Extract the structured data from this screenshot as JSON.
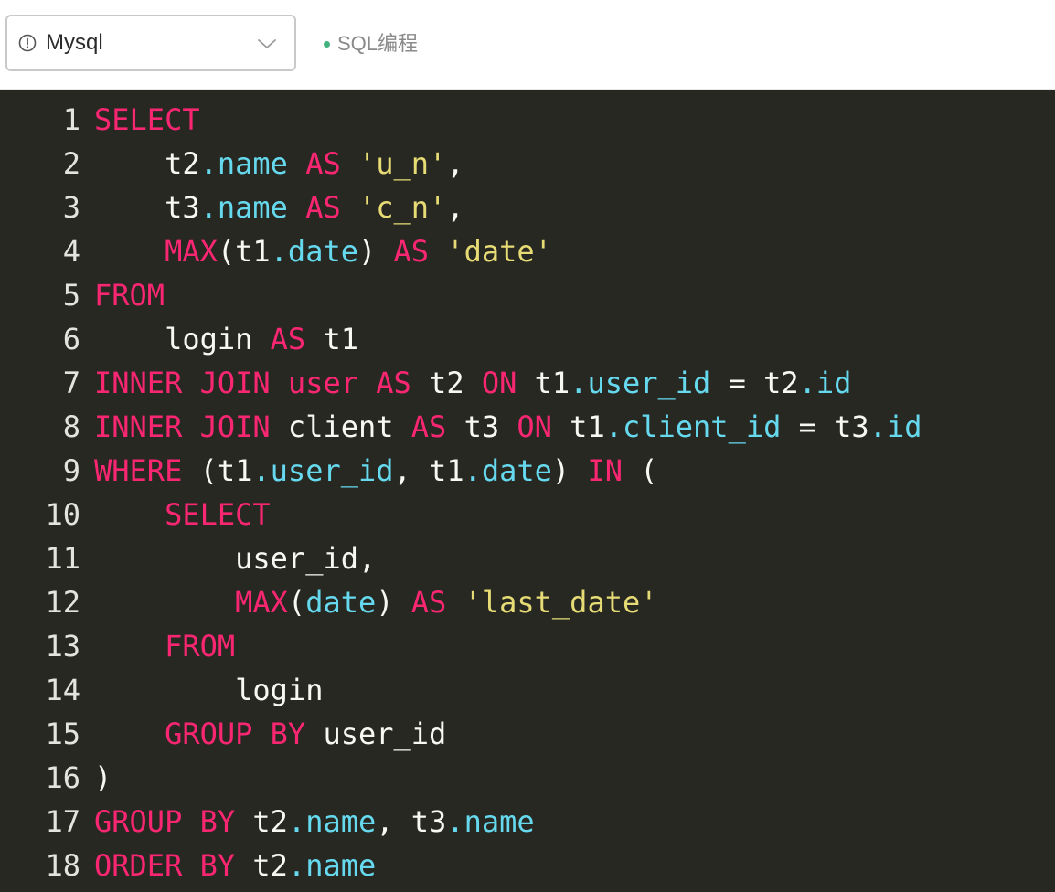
{
  "toolbar": {
    "language_select": {
      "value": "Mysql",
      "icon": "info-circle-icon",
      "chevron": "chevron-down-icon"
    },
    "tag": {
      "label": "SQL编程",
      "dot_color": "#3fb27f"
    }
  },
  "editor": {
    "theme": {
      "background": "#272822",
      "keyword": "#f92672",
      "property": "#66d9ef",
      "string": "#e6db74",
      "plain": "#f8f8f2",
      "line_number": "#e4e4df"
    },
    "lines": [
      {
        "n": "1",
        "tokens": [
          [
            "kw",
            "SELECT"
          ]
        ]
      },
      {
        "n": "2",
        "tokens": [
          [
            "plain",
            "    t2"
          ],
          [
            "prop",
            ".name"
          ],
          [
            "plain",
            " "
          ],
          [
            "kw",
            "AS"
          ],
          [
            "plain",
            " "
          ],
          [
            "str",
            "'u_n'"
          ],
          [
            "plain",
            ","
          ]
        ]
      },
      {
        "n": "3",
        "tokens": [
          [
            "plain",
            "    t3"
          ],
          [
            "prop",
            ".name"
          ],
          [
            "plain",
            " "
          ],
          [
            "kw",
            "AS"
          ],
          [
            "plain",
            " "
          ],
          [
            "str",
            "'c_n'"
          ],
          [
            "plain",
            ","
          ]
        ]
      },
      {
        "n": "4",
        "tokens": [
          [
            "plain",
            "    "
          ],
          [
            "fn",
            "MAX"
          ],
          [
            "plain",
            "(t1"
          ],
          [
            "prop",
            ".date"
          ],
          [
            "plain",
            ") "
          ],
          [
            "kw",
            "AS"
          ],
          [
            "plain",
            " "
          ],
          [
            "str",
            "'date'"
          ]
        ]
      },
      {
        "n": "5",
        "tokens": [
          [
            "kw",
            "FROM"
          ]
        ]
      },
      {
        "n": "6",
        "tokens": [
          [
            "plain",
            "    login "
          ],
          [
            "kw",
            "AS"
          ],
          [
            "plain",
            " t1"
          ]
        ]
      },
      {
        "n": "7",
        "tokens": [
          [
            "kw",
            "INNER"
          ],
          [
            "plain",
            " "
          ],
          [
            "kw",
            "JOIN"
          ],
          [
            "plain",
            " "
          ],
          [
            "kw",
            "user"
          ],
          [
            "plain",
            " "
          ],
          [
            "kw",
            "AS"
          ],
          [
            "plain",
            " t2 "
          ],
          [
            "kw",
            "ON"
          ],
          [
            "plain",
            " t1"
          ],
          [
            "prop",
            ".user_id"
          ],
          [
            "plain",
            " = t2"
          ],
          [
            "prop",
            ".id"
          ]
        ]
      },
      {
        "n": "8",
        "tokens": [
          [
            "kw",
            "INNER"
          ],
          [
            "plain",
            " "
          ],
          [
            "kw",
            "JOIN"
          ],
          [
            "plain",
            " client "
          ],
          [
            "kw",
            "AS"
          ],
          [
            "plain",
            " t3 "
          ],
          [
            "kw",
            "ON"
          ],
          [
            "plain",
            " t1"
          ],
          [
            "prop",
            ".client_id"
          ],
          [
            "plain",
            " = t3"
          ],
          [
            "prop",
            ".id"
          ]
        ]
      },
      {
        "n": "9",
        "tokens": [
          [
            "kw",
            "WHERE"
          ],
          [
            "plain",
            " (t1"
          ],
          [
            "prop",
            ".user_id"
          ],
          [
            "plain",
            ", t1"
          ],
          [
            "prop",
            ".date"
          ],
          [
            "plain",
            ") "
          ],
          [
            "kw",
            "IN"
          ],
          [
            "plain",
            " ("
          ]
        ]
      },
      {
        "n": "10",
        "tokens": [
          [
            "plain",
            "    "
          ],
          [
            "kw",
            "SELECT"
          ]
        ]
      },
      {
        "n": "11",
        "tokens": [
          [
            "plain",
            "        user_id,"
          ]
        ]
      },
      {
        "n": "12",
        "tokens": [
          [
            "plain",
            "        "
          ],
          [
            "fn",
            "MAX"
          ],
          [
            "plain",
            "("
          ],
          [
            "prop",
            "date"
          ],
          [
            "plain",
            ") "
          ],
          [
            "kw",
            "AS"
          ],
          [
            "plain",
            " "
          ],
          [
            "str",
            "'last_date'"
          ]
        ]
      },
      {
        "n": "13",
        "tokens": [
          [
            "plain",
            "    "
          ],
          [
            "kw",
            "FROM"
          ]
        ]
      },
      {
        "n": "14",
        "tokens": [
          [
            "plain",
            "        login"
          ]
        ]
      },
      {
        "n": "15",
        "tokens": [
          [
            "plain",
            "    "
          ],
          [
            "kw",
            "GROUP"
          ],
          [
            "plain",
            " "
          ],
          [
            "kw",
            "BY"
          ],
          [
            "plain",
            " user_id"
          ]
        ]
      },
      {
        "n": "16",
        "tokens": [
          [
            "plain",
            ")"
          ]
        ]
      },
      {
        "n": "17",
        "tokens": [
          [
            "kw",
            "GROUP"
          ],
          [
            "plain",
            " "
          ],
          [
            "kw",
            "BY"
          ],
          [
            "plain",
            " t2"
          ],
          [
            "prop",
            ".name"
          ],
          [
            "plain",
            ", t3"
          ],
          [
            "prop",
            ".name"
          ]
        ]
      },
      {
        "n": "18",
        "tokens": [
          [
            "kw",
            "ORDER"
          ],
          [
            "plain",
            " "
          ],
          [
            "kw",
            "BY"
          ],
          [
            "plain",
            " t2"
          ],
          [
            "prop",
            ".name"
          ]
        ]
      }
    ]
  }
}
